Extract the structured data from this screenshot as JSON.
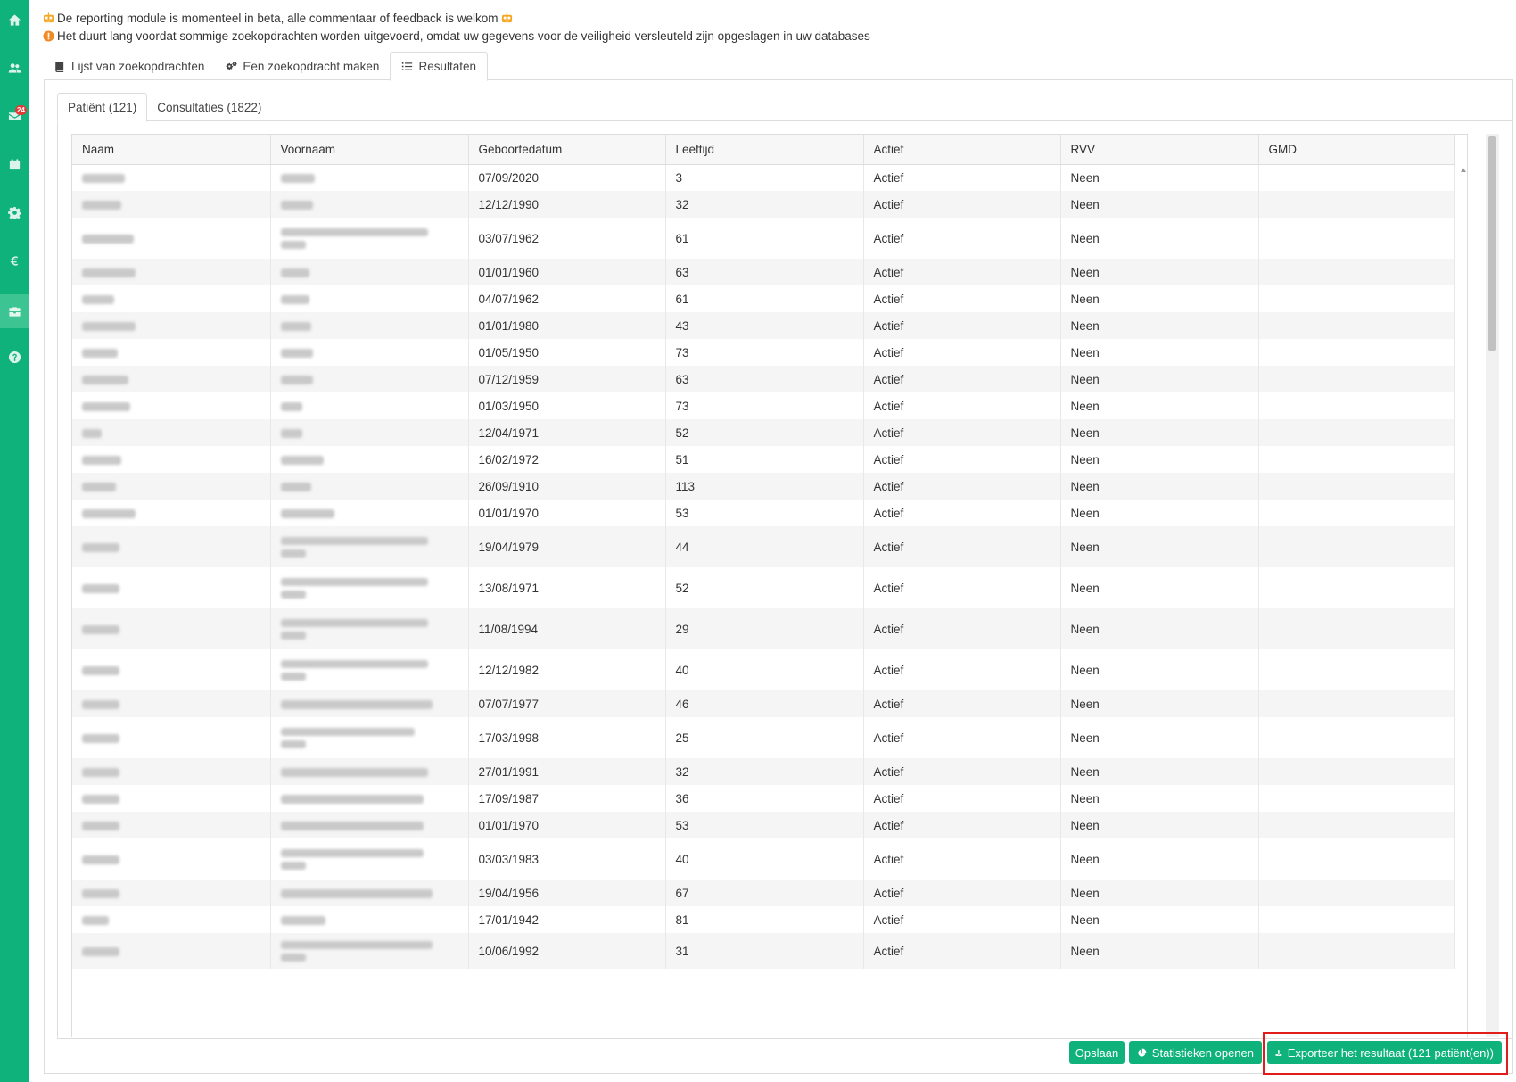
{
  "sidebar": {
    "items": [
      {
        "icon": "home-icon"
      },
      {
        "icon": "users-icon"
      },
      {
        "icon": "mail-icon",
        "badge": "24"
      },
      {
        "icon": "calendar-icon"
      },
      {
        "icon": "gear-icon"
      },
      {
        "icon": "euro-icon"
      },
      {
        "icon": "toolbox-icon",
        "active": true
      },
      {
        "icon": "help-icon"
      }
    ]
  },
  "notices": {
    "beta": "De reporting module is momenteel in beta, alle commentaar of feedback is welkom",
    "slow": "Het duurt lang voordat sommige zoekopdrachten worden uitgevoerd, omdat uw gegevens voor de veiligheid versleuteld zijn opgeslagen in uw databases"
  },
  "tabs": {
    "list": "Lijst van zoekopdrachten",
    "create": "Een zoekopdracht maken",
    "results": "Resultaten"
  },
  "subtabs": {
    "patients": "Patiënt (121)",
    "consultations": "Consultaties (1822)"
  },
  "table": {
    "columns": [
      "Naam",
      "Voornaam",
      "Geboortedatum",
      "Leeftijd",
      "Actief",
      "RVV",
      "GMD"
    ],
    "rows": [
      {
        "dob": "07/09/2020",
        "age": "3",
        "active": "Actief",
        "rvv": "Neen",
        "gmd": ""
      },
      {
        "dob": "12/12/1990",
        "age": "32",
        "active": "Actief",
        "rvv": "Neen",
        "gmd": ""
      },
      {
        "dob": "03/07/1962",
        "age": "61",
        "active": "Actief",
        "rvv": "Neen",
        "gmd": ""
      },
      {
        "dob": "01/01/1960",
        "age": "63",
        "active": "Actief",
        "rvv": "Neen",
        "gmd": ""
      },
      {
        "dob": "04/07/1962",
        "age": "61",
        "active": "Actief",
        "rvv": "Neen",
        "gmd": ""
      },
      {
        "dob": "01/01/1980",
        "age": "43",
        "active": "Actief",
        "rvv": "Neen",
        "gmd": ""
      },
      {
        "dob": "01/05/1950",
        "age": "73",
        "active": "Actief",
        "rvv": "Neen",
        "gmd": ""
      },
      {
        "dob": "07/12/1959",
        "age": "63",
        "active": "Actief",
        "rvv": "Neen",
        "gmd": ""
      },
      {
        "dob": "01/03/1950",
        "age": "73",
        "active": "Actief",
        "rvv": "Neen",
        "gmd": ""
      },
      {
        "dob": "12/04/1971",
        "age": "52",
        "active": "Actief",
        "rvv": "Neen",
        "gmd": ""
      },
      {
        "dob": "16/02/1972",
        "age": "51",
        "active": "Actief",
        "rvv": "Neen",
        "gmd": ""
      },
      {
        "dob": "26/09/1910",
        "age": "113",
        "active": "Actief",
        "rvv": "Neen",
        "gmd": ""
      },
      {
        "dob": "01/01/1970",
        "age": "53",
        "active": "Actief",
        "rvv": "Neen",
        "gmd": ""
      },
      {
        "dob": "19/04/1979",
        "age": "44",
        "active": "Actief",
        "rvv": "Neen",
        "gmd": ""
      },
      {
        "dob": "13/08/1971",
        "age": "52",
        "active": "Actief",
        "rvv": "Neen",
        "gmd": ""
      },
      {
        "dob": "11/08/1994",
        "age": "29",
        "active": "Actief",
        "rvv": "Neen",
        "gmd": ""
      },
      {
        "dob": "12/12/1982",
        "age": "40",
        "active": "Actief",
        "rvv": "Neen",
        "gmd": ""
      },
      {
        "dob": "07/07/1977",
        "age": "46",
        "active": "Actief",
        "rvv": "Neen",
        "gmd": ""
      },
      {
        "dob": "17/03/1998",
        "age": "25",
        "active": "Actief",
        "rvv": "Neen",
        "gmd": ""
      },
      {
        "dob": "27/01/1991",
        "age": "32",
        "active": "Actief",
        "rvv": "Neen",
        "gmd": ""
      },
      {
        "dob": "17/09/1987",
        "age": "36",
        "active": "Actief",
        "rvv": "Neen",
        "gmd": ""
      },
      {
        "dob": "01/01/1970",
        "age": "53",
        "active": "Actief",
        "rvv": "Neen",
        "gmd": ""
      },
      {
        "dob": "03/03/1983",
        "age": "40",
        "active": "Actief",
        "rvv": "Neen",
        "gmd": ""
      },
      {
        "dob": "19/04/1956",
        "age": "67",
        "active": "Actief",
        "rvv": "Neen",
        "gmd": ""
      },
      {
        "dob": "17/01/1942",
        "age": "81",
        "active": "Actief",
        "rvv": "Neen",
        "gmd": ""
      },
      {
        "dob": "10/06/1992",
        "age": "31",
        "active": "Actief",
        "rvv": "Neen",
        "gmd": ""
      }
    ]
  },
  "buttons": {
    "save": "Opslaan",
    "stats": "Statistieken openen",
    "export": "Exporteer het resultaat (121 patiënt(en))"
  },
  "colors": {
    "brand": "#0fb27a",
    "highlight": "#e21b1b"
  }
}
